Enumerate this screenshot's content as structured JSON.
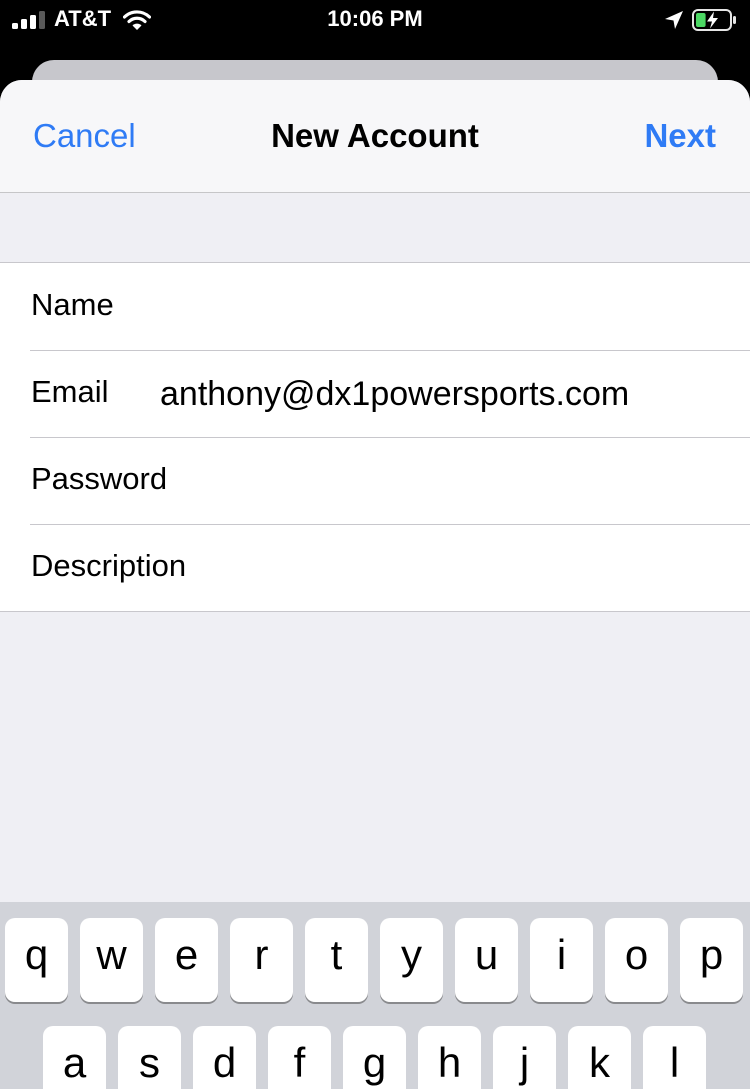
{
  "status_bar": {
    "carrier": "AT&T",
    "time": "10:06 PM",
    "signal_bars": 3,
    "battery_level_percent": 30,
    "battery_charging": true
  },
  "nav": {
    "cancel_label": "Cancel",
    "title": "New Account",
    "next_label": "Next"
  },
  "form": {
    "rows": [
      {
        "label": "Name",
        "value": ""
      },
      {
        "label": "Email",
        "value": "anthony@dx1powersports.com"
      },
      {
        "label": "Password",
        "value": ""
      },
      {
        "label": "Description",
        "value": ""
      }
    ]
  },
  "keyboard": {
    "row1": [
      "q",
      "w",
      "e",
      "r",
      "t",
      "y",
      "u",
      "i",
      "o",
      "p"
    ],
    "row2": [
      "a",
      "s",
      "d",
      "f",
      "g",
      "h",
      "j",
      "k",
      "l"
    ]
  },
  "colors": {
    "accent": "#2f7bf5",
    "background": "#efeff4",
    "keyboard": "#d1d3d9",
    "battery_fill": "#4cd964"
  },
  "icons": {
    "signal": "cellular-signal-icon",
    "wifi": "wifi-icon",
    "location": "location-arrow-icon",
    "battery": "battery-charging-icon"
  }
}
